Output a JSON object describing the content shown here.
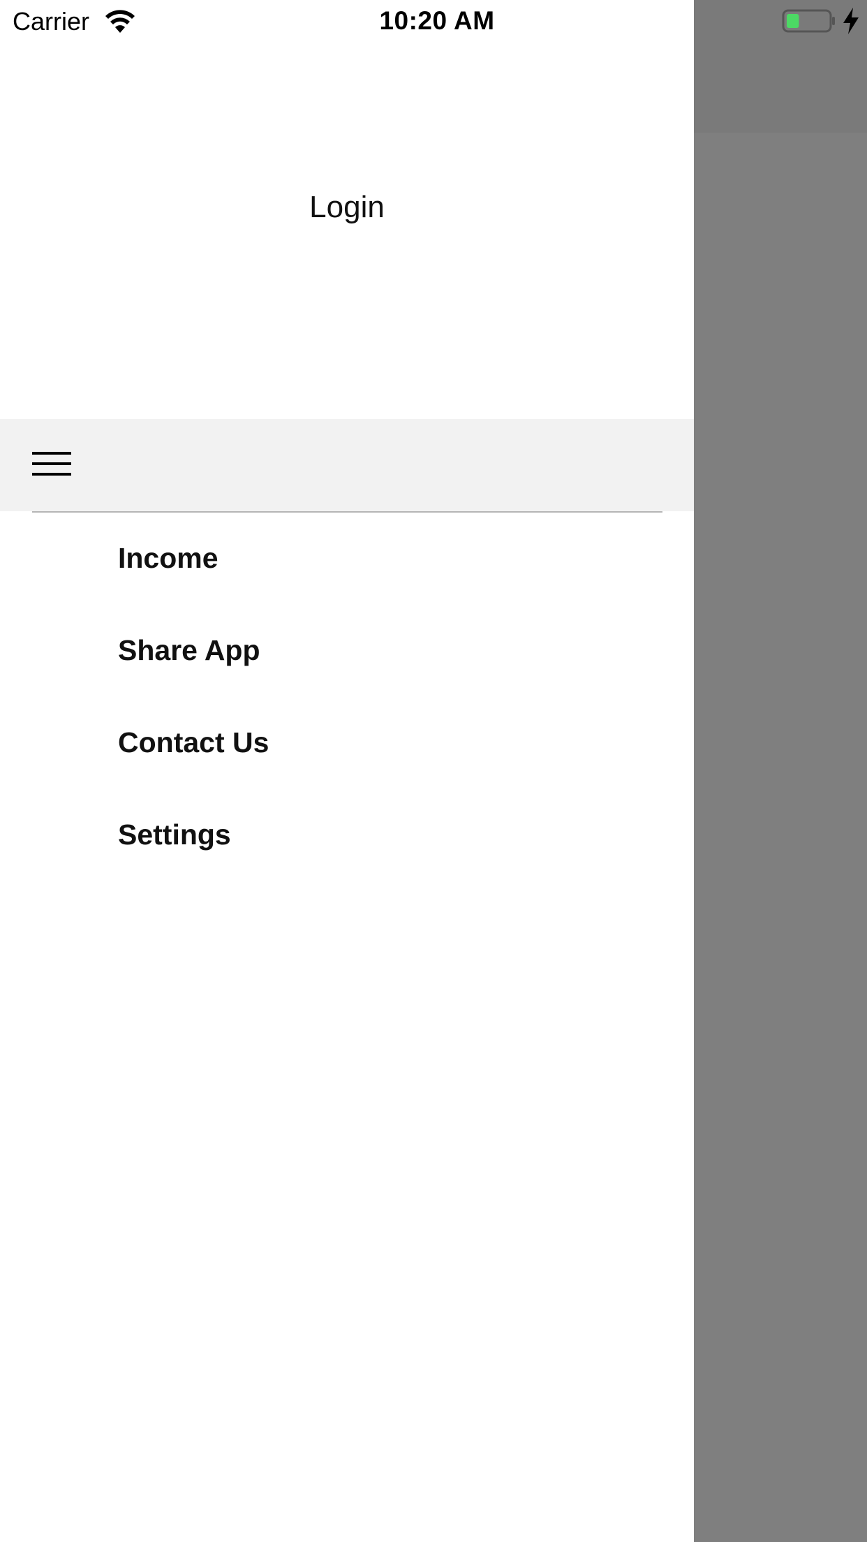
{
  "status_bar": {
    "carrier": "Carrier",
    "time": "10:20 AM",
    "battery_level": 0.3,
    "battery_color": "#4cd964"
  },
  "header": {
    "title": "Login"
  },
  "toolbar": {
    "menu_icon": "hamburger-menu-icon"
  },
  "menu": {
    "items": [
      {
        "label": "Income"
      },
      {
        "label": "Share App"
      },
      {
        "label": "Contact Us"
      },
      {
        "label": "Settings"
      }
    ]
  },
  "colors": {
    "backdrop": "#7f7f7f",
    "toolbar_bg": "#f2f2f2",
    "divider": "#b5b5b5"
  }
}
